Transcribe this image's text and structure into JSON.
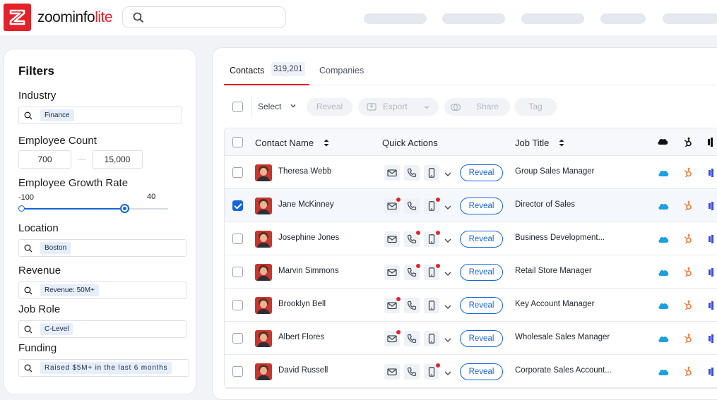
{
  "app": {
    "logo_main": "zoominfo",
    "logo_accent": "lite",
    "brand_color": "#e3212b"
  },
  "search": {
    "placeholder": ""
  },
  "filters": {
    "title": "Filters",
    "industry": {
      "label": "Industry",
      "value": "Finance"
    },
    "employee_count": {
      "label": "Employee Count",
      "min": "700",
      "max": "15,000"
    },
    "growth_rate": {
      "label": "Employee Growth Rate",
      "min_label": "-100",
      "max_label": "40",
      "range_min": -100,
      "range_max": 100,
      "value_low": -100,
      "value_high": 40
    },
    "location": {
      "label": "Location",
      "value": "Boston"
    },
    "revenue": {
      "label": "Revenue",
      "value": "Revenue: 50M+"
    },
    "job_role": {
      "label": "Job Role",
      "value": "C-Level"
    },
    "funding": {
      "label": "Funding",
      "value": "Raised $5M+ in the last 6 months"
    }
  },
  "tabs": {
    "contacts": "Contacts",
    "contacts_count": "319,201",
    "companies": "Companies"
  },
  "toolbar": {
    "select": "Select",
    "reveal": "Reveal",
    "export": "Export",
    "share": "Share",
    "tag": "Tag"
  },
  "table": {
    "headers": {
      "name": "Contact Name",
      "quick_actions": "Quick Actions",
      "job_title": "Job Title"
    },
    "reveal_label": "Reveal",
    "rows": [
      {
        "name": "Theresa Webb",
        "title": "Group Sales Manager",
        "checked": false,
        "email_dot": false,
        "phone_dot": false,
        "mobile_dot": false
      },
      {
        "name": "Jane McKinney",
        "title": "Director of Sales",
        "checked": true,
        "email_dot": true,
        "phone_dot": false,
        "mobile_dot": true
      },
      {
        "name": "Josephine Jones",
        "title": "Business Development...",
        "checked": false,
        "email_dot": false,
        "phone_dot": true,
        "mobile_dot": true
      },
      {
        "name": "Marvin Simmons",
        "title": "Retail Store Manager",
        "checked": false,
        "email_dot": false,
        "phone_dot": true,
        "mobile_dot": true
      },
      {
        "name": "Brooklyn Bell",
        "title": "Key Account Manager",
        "checked": false,
        "email_dot": true,
        "phone_dot": false,
        "mobile_dot": false
      },
      {
        "name": "Albert Flores",
        "title": "Wholesale Sales Manager",
        "checked": false,
        "email_dot": true,
        "phone_dot": false,
        "mobile_dot": false
      },
      {
        "name": "David Russell",
        "title": "Corporate Sales Account...",
        "checked": false,
        "email_dot": false,
        "phone_dot": false,
        "mobile_dot": true
      }
    ]
  },
  "colors": {
    "accent": "#1565d8",
    "salesforce": "#1ba0e0",
    "hubspot": "#ee7d3b",
    "integration": "#3a4bd8"
  }
}
